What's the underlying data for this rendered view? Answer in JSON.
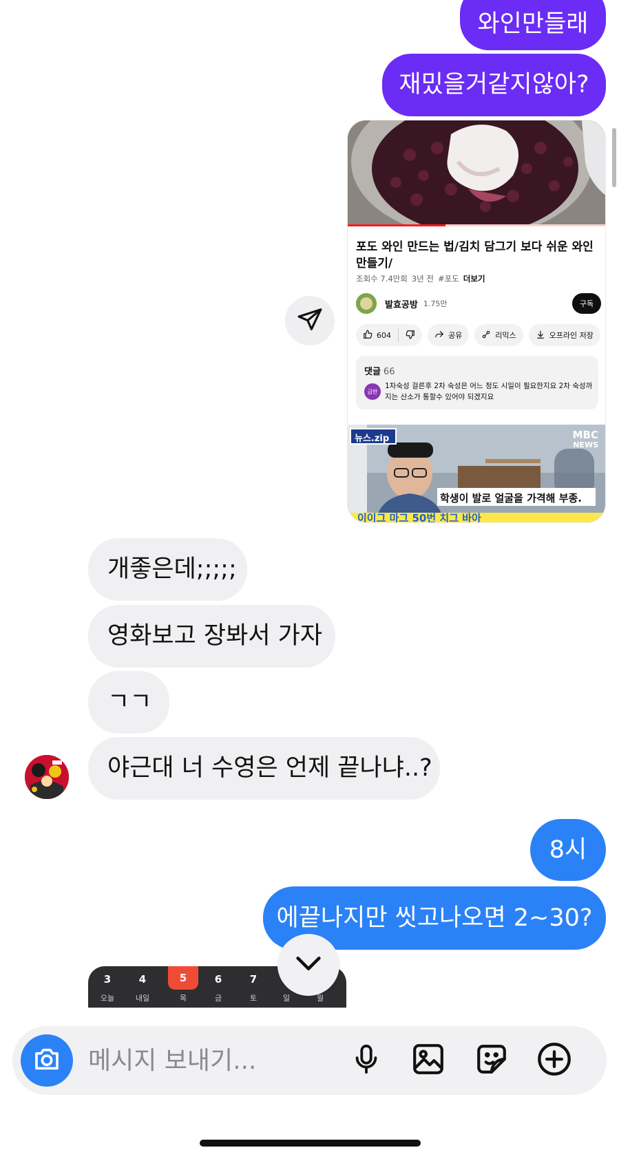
{
  "messages": {
    "top_sent": [
      {
        "text": "와인만들래"
      },
      {
        "text": "재밌을거같지않아?"
      }
    ],
    "received": [
      {
        "text": "개좋은데;;;;;"
      },
      {
        "text": "영화보고 장봐서 가자"
      },
      {
        "text": "ㄱㄱ"
      },
      {
        "text": "야근대 너 수영은 언제 끝나냐..?"
      }
    ],
    "bottom_sent": [
      {
        "text": "8시"
      },
      {
        "text": "에끝나지만 씻고나오면 2~30?"
      }
    ]
  },
  "shared_video": {
    "title": "포도 와인 만드는 법/김치 담그기 보다 쉬운 와인 만들기/",
    "views": "조회수 7.4만회",
    "age": "3년 전",
    "hashtag": "#포도",
    "more": "더보기",
    "progress": 0.38,
    "channel": {
      "avatar_text": "발효공방",
      "name": "발효공방",
      "subscribers": "1.75만",
      "subscribe_label": "구독"
    },
    "actions": {
      "likes": "604",
      "share": "공유",
      "remix": "리믹스",
      "offline": "오프라인 저장"
    },
    "comments": {
      "title": "댓글",
      "count": "66",
      "avatar_text": "금란",
      "text": "1차숙성 걸른후 2차 숙성은 어느 정도 시일이 필요한지요 2차 숙성까지는 산소가 통할수 있어야  되겠지요"
    },
    "next_video": {
      "badge": "뉴스.zip",
      "brand_top": "MBC",
      "brand_bottom": "NEWS",
      "caption": "학생이 발로 얼굴을 가격해 부종.",
      "bottom_caption": "이이그 마그 50번 치그 바아"
    }
  },
  "calendar": {
    "days": [
      {
        "num": "3",
        "label": "오늘"
      },
      {
        "num": "4",
        "label": "내일"
      },
      {
        "num": "5",
        "label": "목"
      },
      {
        "num": "6",
        "label": "금"
      },
      {
        "num": "7",
        "label": "토"
      },
      {
        "num": "",
        "label": "일"
      },
      {
        "num": "",
        "label": "월"
      }
    ],
    "active_index": 2,
    "active_color": "#f04b36"
  },
  "composer": {
    "placeholder": "메시지 보내기..."
  },
  "icons": {
    "share": "paper-plane-icon",
    "scroll_down": "chevron-down-icon",
    "camera": "camera-icon",
    "mic": "microphone-icon",
    "gallery": "image-icon",
    "sticker": "sticker-icon",
    "more": "plus-circle-icon"
  },
  "colors": {
    "sent_purple": "#6b2cf5",
    "sent_blue": "#2b82f7",
    "received": "#f0f0f2",
    "youtube_red": "#ff1a1a"
  }
}
